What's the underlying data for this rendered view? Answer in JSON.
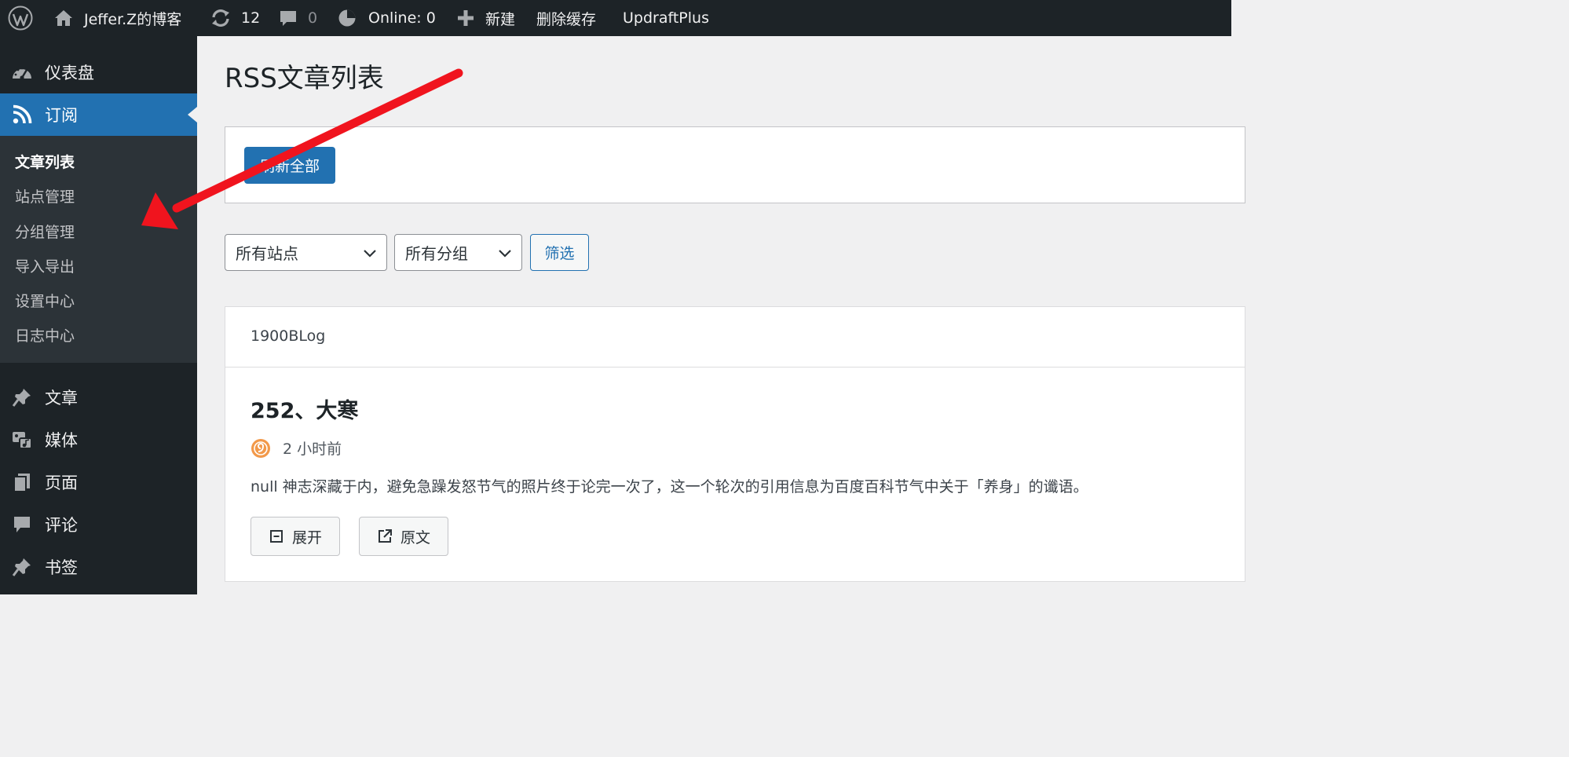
{
  "adminbar": {
    "site_name": "Jeffer.Z的博客",
    "updates_count": "12",
    "comments_count": "0",
    "online_label": "Online: 0",
    "new_label": "新建",
    "clear_cache_label": "删除缓存",
    "updraft_label": "UpdraftPlus"
  },
  "sidebar": {
    "dashboard": "仪表盘",
    "subscribe": "订阅",
    "submenu": [
      "文章列表",
      "站点管理",
      "分组管理",
      "导入导出",
      "设置中心",
      "日志中心"
    ],
    "posts": "文章",
    "media": "媒体",
    "pages": "页面",
    "comments": "评论",
    "bookmarks": "书签"
  },
  "main": {
    "title": "RSS文章列表",
    "refresh_all_label": "刷新全部",
    "site_filter": "所有站点",
    "group_filter": "所有分组",
    "filter_button": "筛选"
  },
  "feed": {
    "site": "1900BLog",
    "post_title": "252、大寒",
    "post_time": "2 小时前",
    "excerpt": "null 神志深藏于内，避免急躁发怒节气的照片终于论完一次了，这一个轮次的引用信息为百度百科节气中关于「养身」的谶语。",
    "expand_label": "展开",
    "original_label": "原文"
  },
  "colors": {
    "admin_dark": "#1d2327",
    "submenu_bg": "#2c3338",
    "accent_blue": "#2271b1",
    "annotation_red": "#f0141e"
  }
}
